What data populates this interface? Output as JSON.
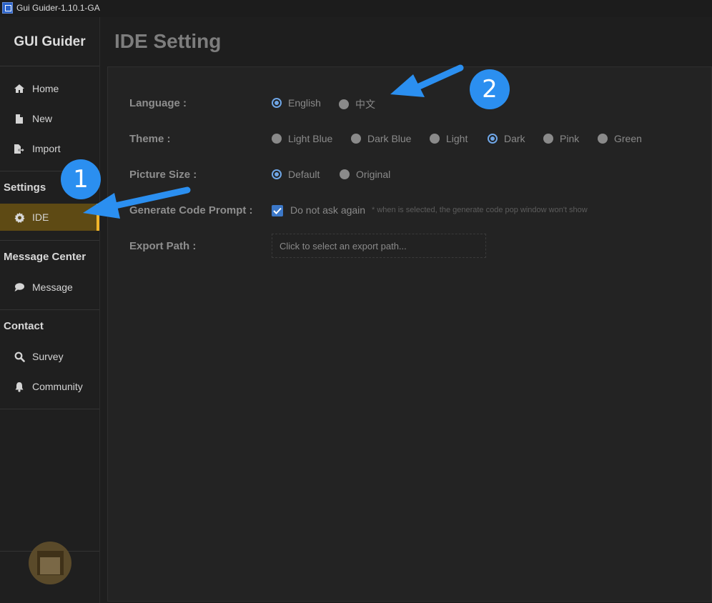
{
  "window": {
    "title": "Gui Guider-1.10.1-GA"
  },
  "sidebar": {
    "brand": "GUI Guider",
    "items": [
      {
        "label": "Home",
        "icon": "home-icon"
      },
      {
        "label": "New",
        "icon": "file-icon"
      },
      {
        "label": "Import",
        "icon": "import-icon"
      }
    ],
    "settings": {
      "title": "Settings",
      "items": [
        {
          "label": "IDE",
          "icon": "gear-icon",
          "active": true
        }
      ]
    },
    "message_center": {
      "title": "Message Center",
      "items": [
        {
          "label": "Message",
          "icon": "chat-bubble-icon"
        }
      ]
    },
    "contact": {
      "title": "Contact",
      "items": [
        {
          "label": "Survey",
          "icon": "search-icon"
        },
        {
          "label": "Community",
          "icon": "bell-icon"
        }
      ]
    },
    "accent_color": "#f0b429",
    "active_bg": "#5e4a14"
  },
  "main": {
    "title": "IDE Setting",
    "language": {
      "label": "Language :",
      "options": [
        "English",
        "中文"
      ],
      "selected": "English"
    },
    "theme": {
      "label": "Theme :",
      "options": [
        "Light Blue",
        "Dark Blue",
        "Light",
        "Dark",
        "Pink",
        "Green"
      ],
      "selected": "Dark"
    },
    "picture_size": {
      "label": "Picture Size :",
      "options": [
        "Default",
        "Original"
      ],
      "selected": "Default"
    },
    "generate_code_prompt": {
      "label": "Generate Code Prompt :",
      "checkbox_label": "Do not ask again",
      "checked": true,
      "hint": "* when is selected, the generate code pop window won't show"
    },
    "export_path": {
      "label": "Export Path :",
      "placeholder": "Click to select an export path..."
    }
  },
  "annotations": {
    "callout_1": "1",
    "callout_2": "2",
    "color": "#2b8ff0"
  }
}
